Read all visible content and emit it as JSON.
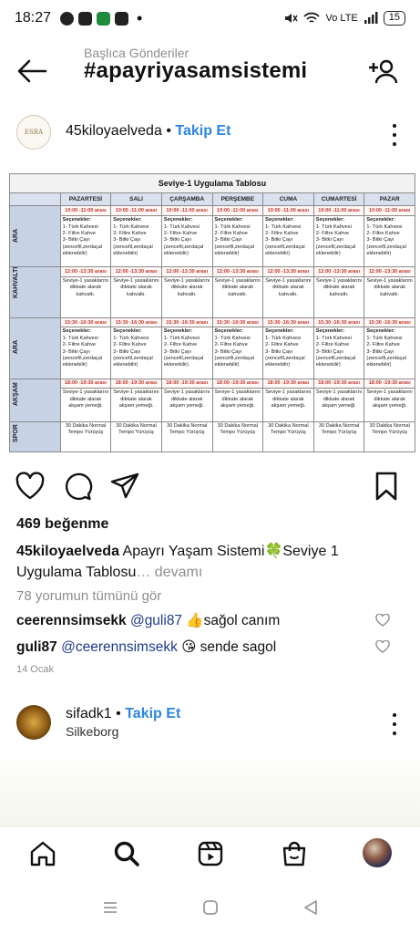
{
  "status_bar": {
    "time": "18:27",
    "network_label": "Vo LTE",
    "battery": "15"
  },
  "header": {
    "subtitle": "Başlıca Gönderiler",
    "title": "#apayriyasamsistemi"
  },
  "post1": {
    "avatar_text": "ESRA",
    "username": "45kiloyaelveda",
    "follow": "Takip Et",
    "separator": "•",
    "likes": "469 beğenme",
    "caption_user": "45kiloyaelveda",
    "caption_text": "Apayrı Yaşam Sistemi🍀Seviye 1 Uygulama Tablosu",
    "caption_more": "… devamı",
    "view_comments": "78 yorumun tümünü gör",
    "comments": [
      {
        "user": "ceerennsimsekk",
        "mention": "@guli87",
        "text": " 👍sağol canım"
      },
      {
        "user": "guli87",
        "mention": "@ceerennsimsekk",
        "text": " 😘 sende sagol"
      }
    ],
    "date": "14 Ocak",
    "table": {
      "title": "Seviye-1 Uygulama Tablosu",
      "days": [
        "PAZARTESİ",
        "SALI",
        "ÇARŞAMBA",
        "PERŞEMBE",
        "CUMA",
        "CUMARTESİ",
        "PAZAR"
      ],
      "row_labels": [
        "ARA",
        "KAHVALTI",
        "ARA",
        "AKŞAM",
        "SPOR"
      ],
      "time_ara1": "10:00 -11:00 arası",
      "time_kahvalti": "12:00 -13:30 arası",
      "time_ara2": "15:30 -16:30 arası",
      "time_aksam": "18:00 -19:30 arası",
      "ara_options_title": "Seçenekler:",
      "ara_options_1": "1- Türk Kahvesi",
      "ara_options_2": "2- Filtre Kahve",
      "ara_options_3": "3- Bitki Çayı",
      "ara_options_4": "(zencefil,zerdaçal eklenebilir)",
      "kahvalti_text": "Seviye-1 yasaklarını dikkate alarak kahvaltı.",
      "aksam_text": "Seviye-1 yasaklarını dikkate alarak akşam yemeği.",
      "spor_text": "30 Dakika Normal Tempo Yürüyüş"
    }
  },
  "post2": {
    "username": "sifadk1",
    "follow": "Takip Et",
    "separator": "•",
    "location": "Silkeborg"
  },
  "icons": {
    "back": "arrow-left-icon",
    "follow_tag": "person-add-icon",
    "like": "heart-icon",
    "comment": "comment-icon",
    "share": "send-icon",
    "save": "bookmark-icon"
  },
  "colors": {
    "follow_blue": "#2e86de",
    "muted": "#8e8e8e",
    "time_red": "#c0392b"
  }
}
